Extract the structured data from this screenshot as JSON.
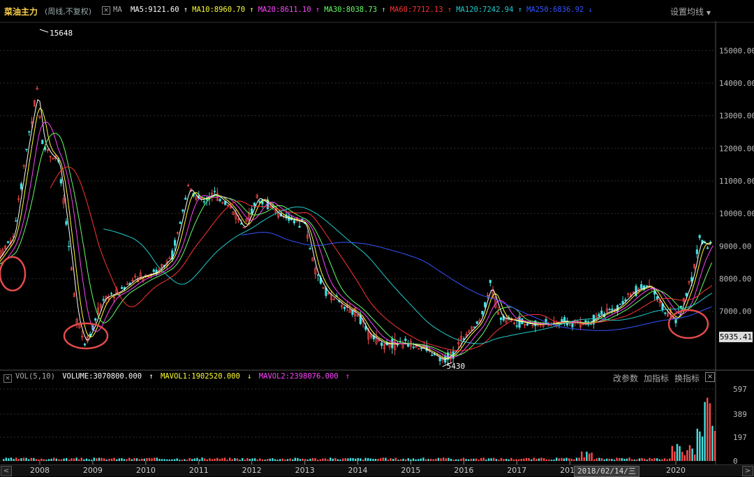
{
  "header": {
    "title": "菜油主力",
    "subtitle": "(周线,不复权)",
    "close_glyph": "×",
    "ma_label": "MA",
    "settings_label": "设置均线",
    "settings_caret": "▼",
    "ma_items": [
      {
        "text": "MA5:9121.60",
        "arrow": "↑",
        "color": "#ffffff"
      },
      {
        "text": "MA10:8960.70",
        "arrow": "↑",
        "color": "#ffff33"
      },
      {
        "text": "MA20:8611.10",
        "arrow": "↑",
        "color": "#ff44ff"
      },
      {
        "text": "MA30:8038.73",
        "arrow": "↑",
        "color": "#66ff66"
      },
      {
        "text": "MA60:7712.13",
        "arrow": "↑",
        "color": "#ff3333"
      },
      {
        "text": "MA120:7242.94",
        "arrow": "↑",
        "color": "#22cccc"
      },
      {
        "text": "MA250:6836.92",
        "arrow": "↓",
        "color": "#3355ff"
      }
    ]
  },
  "chart_data": {
    "type": "candlestick",
    "y_ticks": [
      "15000.00",
      "14000.00",
      "13000.00",
      "12000.00",
      "11000.00",
      "10000.00",
      "9000.00",
      "8000.00",
      "7000.00"
    ],
    "ylim": [
      5300,
      15800
    ],
    "x_ticks": [
      "2008",
      "2009",
      "2010",
      "2011",
      "2012",
      "2013",
      "2014",
      "2015",
      "2016",
      "2017",
      "2018",
      "2020"
    ],
    "high_label": "15648",
    "low_label": "5430",
    "current_price": "5935.41",
    "price_path": [
      [
        2007.0,
        8200
      ],
      [
        2007.2,
        8600
      ],
      [
        2007.5,
        9300
      ],
      [
        2007.8,
        12500
      ],
      [
        2007.95,
        13800
      ],
      [
        2008.05,
        12200
      ],
      [
        2008.2,
        11800
      ],
      [
        2008.35,
        11600
      ],
      [
        2008.55,
        9000
      ],
      [
        2008.7,
        6800
      ],
      [
        2008.85,
        6000
      ],
      [
        2009.0,
        6500
      ],
      [
        2009.2,
        7400
      ],
      [
        2009.5,
        7600
      ],
      [
        2009.8,
        8000
      ],
      [
        2010.2,
        8200
      ],
      [
        2010.5,
        8700
      ],
      [
        2010.8,
        10800
      ],
      [
        2011.0,
        10400
      ],
      [
        2011.3,
        10600
      ],
      [
        2011.6,
        10200
      ],
      [
        2011.85,
        9500
      ],
      [
        2012.1,
        10500
      ],
      [
        2012.3,
        10300
      ],
      [
        2012.55,
        9900
      ],
      [
        2012.8,
        9800
      ],
      [
        2013.0,
        9700
      ],
      [
        2013.2,
        8200
      ],
      [
        2013.4,
        7600
      ],
      [
        2013.7,
        7200
      ],
      [
        2014.0,
        6900
      ],
      [
        2014.2,
        6300
      ],
      [
        2014.5,
        6000
      ],
      [
        2014.8,
        6000
      ],
      [
        2015.0,
        6000
      ],
      [
        2015.3,
        5800
      ],
      [
        2015.6,
        5500
      ],
      [
        2015.8,
        5700
      ],
      [
        2016.0,
        6200
      ],
      [
        2016.3,
        6700
      ],
      [
        2016.5,
        7800
      ],
      [
        2016.7,
        6800
      ],
      [
        2017.0,
        6700
      ],
      [
        2017.3,
        6600
      ],
      [
        2017.6,
        6600
      ],
      [
        2017.9,
        6700
      ],
      [
        2018.3,
        6600
      ],
      [
        2018.6,
        6900
      ],
      [
        2018.9,
        7100
      ],
      [
        2019.2,
        7600
      ],
      [
        2019.5,
        7800
      ],
      [
        2019.8,
        7000
      ],
      [
        2020.0,
        6700
      ],
      [
        2020.3,
        8000
      ],
      [
        2020.45,
        9200
      ],
      [
        2020.6,
        9000
      ],
      [
        2020.7,
        9300
      ]
    ],
    "volume": {
      "label": "VOL(5,10)",
      "volume_text": "VOLUME:3070800.000",
      "mavol1_text": "MAVOL1:1902520.000",
      "mavol2_text": "MAVOL2:2398076.000",
      "y_ticks": [
        "597",
        "389",
        "197",
        "0"
      ]
    }
  },
  "volume_panel": {
    "buttons": [
      "改参数",
      "加指标",
      "换指标"
    ],
    "close_glyph": "×"
  },
  "bottom": {
    "scroll_left": "<",
    "scroll_right": ">",
    "date_label": "2018/02/14/三"
  }
}
